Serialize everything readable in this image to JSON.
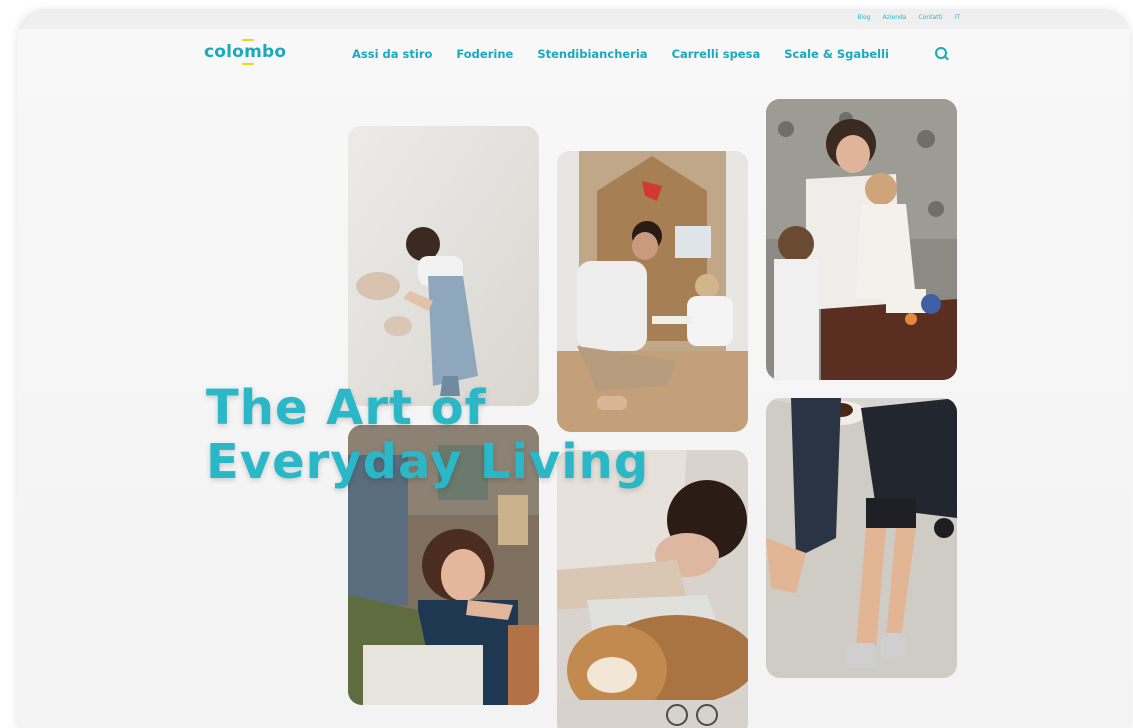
{
  "utility_nav": [
    "Blog",
    "Azienda",
    "Contatti",
    "IT"
  ],
  "logo": "colombo",
  "nav": [
    "Assi da stiro",
    "Foderine",
    "Stendibiancheria",
    "Carrelli spesa",
    "Scale & Sgabelli"
  ],
  "hero": {
    "line1": "The Art of",
    "line2": "Everyday Living"
  },
  "colors": {
    "accent": "#1aa9bd",
    "logo_mark": "#f2d31a"
  },
  "icons": {
    "search": "search-icon"
  },
  "photos": [
    "photo-girl-painting-wall",
    "photo-father-child-cardboard-house",
    "photo-mother-children-kitchen",
    "photo-woman-laughing-with-friends",
    "photo-woman-sleeping-with-dog",
    "photo-couple-on-floor"
  ]
}
